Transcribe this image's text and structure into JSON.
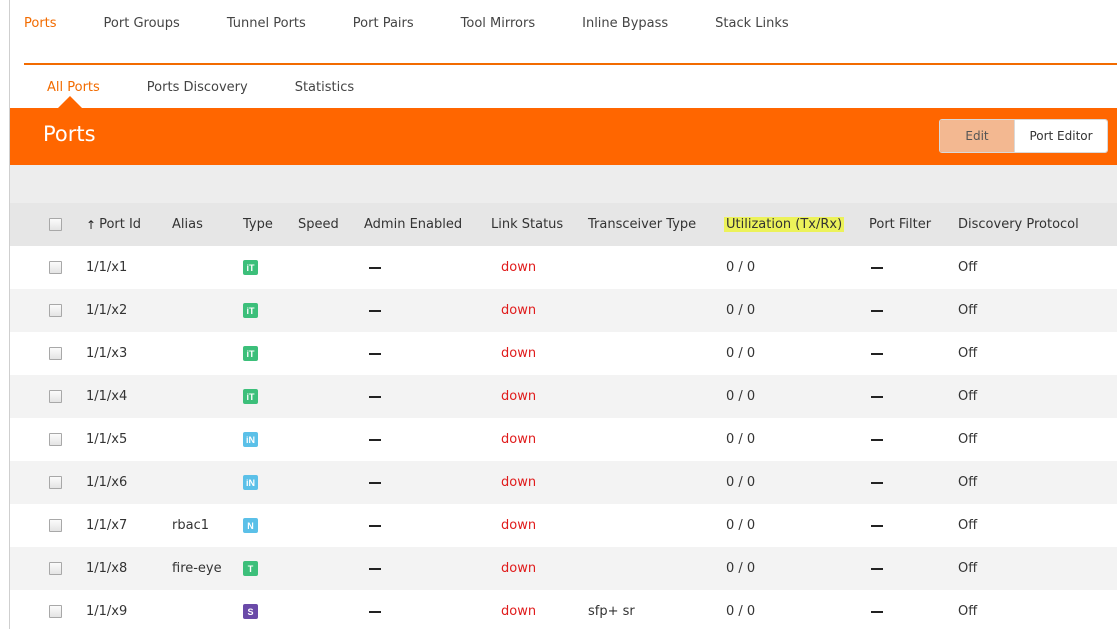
{
  "top_tabs": [
    {
      "label": "Ports",
      "active": true
    },
    {
      "label": "Port Groups",
      "active": false
    },
    {
      "label": "Tunnel Ports",
      "active": false
    },
    {
      "label": "Port Pairs",
      "active": false
    },
    {
      "label": "Tool Mirrors",
      "active": false
    },
    {
      "label": "Inline Bypass",
      "active": false
    },
    {
      "label": "Stack Links",
      "active": false
    }
  ],
  "sub_tabs": [
    {
      "label": "All Ports",
      "active": true
    },
    {
      "label": "Ports Discovery",
      "active": false
    },
    {
      "label": "Statistics",
      "active": false
    }
  ],
  "header": {
    "title": "Ports",
    "edit_label": "Edit",
    "port_editor_label": "Port Editor"
  },
  "colors": {
    "accent": "#ff6600",
    "tab_active": "#f26b00",
    "link_down": "#e01b1b",
    "highlight": "#ecf25a"
  },
  "table": {
    "columns": {
      "port_id": "Port Id",
      "alias": "Alias",
      "type": "Type",
      "speed": "Speed",
      "admin_enabled": "Admin Enabled",
      "link_status": "Link Status",
      "transceiver_type": "Transceiver Type",
      "utilization": "Utilization (Tx/Rx)",
      "port_filter": "Port Filter",
      "discovery_protocol": "Discovery Protocol"
    },
    "sort_icon": "arrow-up-icon",
    "rows": [
      {
        "port_id": "1/1/x1",
        "alias": "",
        "type": "iT",
        "type_color": "#3cbf7a",
        "link_status": "down",
        "transceiver": "",
        "utilization": "0 / 0",
        "discovery": "Off"
      },
      {
        "port_id": "1/1/x2",
        "alias": "",
        "type": "iT",
        "type_color": "#3cbf7a",
        "link_status": "down",
        "transceiver": "",
        "utilization": "0 / 0",
        "discovery": "Off"
      },
      {
        "port_id": "1/1/x3",
        "alias": "",
        "type": "iT",
        "type_color": "#3cbf7a",
        "link_status": "down",
        "transceiver": "",
        "utilization": "0 / 0",
        "discovery": "Off"
      },
      {
        "port_id": "1/1/x4",
        "alias": "",
        "type": "iT",
        "type_color": "#3cbf7a",
        "link_status": "down",
        "transceiver": "",
        "utilization": "0 / 0",
        "discovery": "Off"
      },
      {
        "port_id": "1/1/x5",
        "alias": "",
        "type": "iN",
        "type_color": "#5bc0e8",
        "link_status": "down",
        "transceiver": "",
        "utilization": "0 / 0",
        "discovery": "Off"
      },
      {
        "port_id": "1/1/x6",
        "alias": "",
        "type": "iN",
        "type_color": "#5bc0e8",
        "link_status": "down",
        "transceiver": "",
        "utilization": "0 / 0",
        "discovery": "Off"
      },
      {
        "port_id": "1/1/x7",
        "alias": "rbac1",
        "type": "N",
        "type_color": "#5bc0e8",
        "link_status": "down",
        "transceiver": "",
        "utilization": "0 / 0",
        "discovery": "Off"
      },
      {
        "port_id": "1/1/x8",
        "alias": "fire-eye",
        "type": "T",
        "type_color": "#3cbf7a",
        "link_status": "down",
        "transceiver": "",
        "utilization": "0 / 0",
        "discovery": "Off"
      },
      {
        "port_id": "1/1/x9",
        "alias": "",
        "type": "S",
        "type_color": "#6a4aa8",
        "link_status": "down",
        "transceiver": "sfp+ sr",
        "utilization": "0 / 0",
        "discovery": "Off"
      }
    ]
  }
}
